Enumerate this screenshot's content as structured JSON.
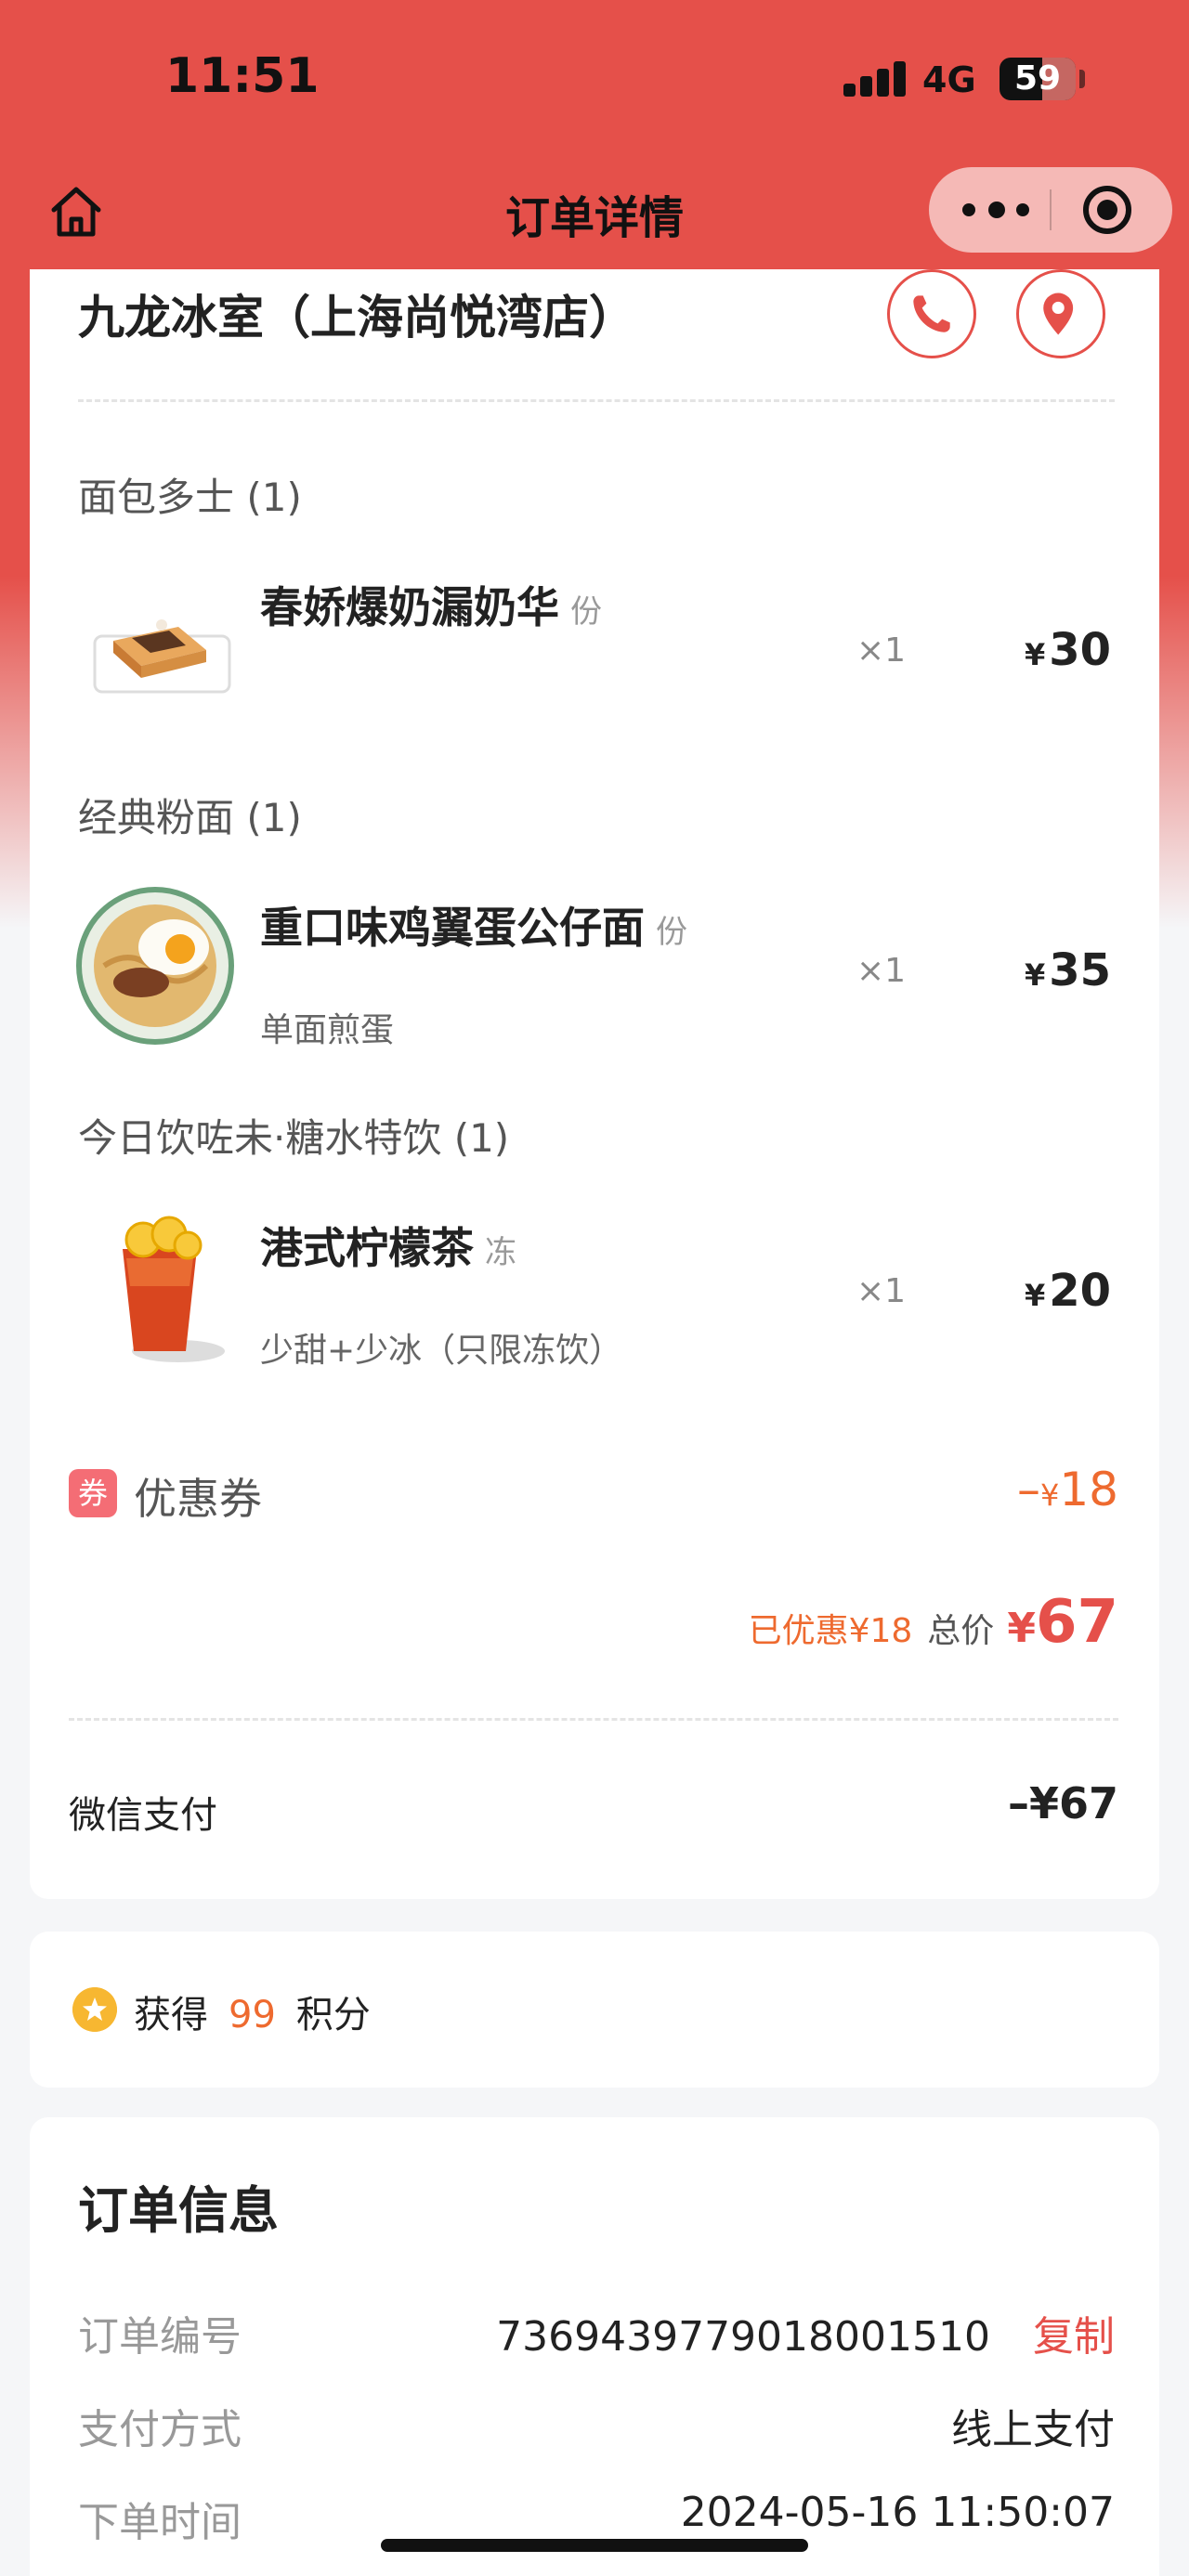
{
  "status_bar": {
    "time": "11:51",
    "network": "4G",
    "battery": "59"
  },
  "nav": {
    "title": "订单详情"
  },
  "store": {
    "name": "九龙冰室（上海尚悦湾店）"
  },
  "categories": [
    {
      "name": "面包多士 (1)",
      "items": [
        {
          "name": "春娇爆奶漏奶华",
          "unit": "份",
          "spec": "",
          "qty": "×1",
          "currency": "¥",
          "price": "30"
        }
      ]
    },
    {
      "name": "经典粉面 (1)",
      "items": [
        {
          "name": "重口味鸡翼蛋公仔面",
          "unit": "份",
          "spec": "单面煎蛋",
          "qty": "×1",
          "currency": "¥",
          "price": "35"
        }
      ]
    },
    {
      "name": "今日饮咗未·糖水特饮 (1)",
      "items": [
        {
          "name": "港式柠檬茶",
          "unit": "冻",
          "spec": "少甜+少冰（只限冻饮）",
          "qty": "×1",
          "currency": "¥",
          "price": "20"
        }
      ]
    }
  ],
  "coupon": {
    "badge": "券",
    "label": "优惠券",
    "prefix": "–",
    "currency": "¥",
    "amount": "18"
  },
  "summary": {
    "saved": "已优惠¥18",
    "total_label": "总价",
    "currency": "¥",
    "total": "67"
  },
  "payment": {
    "label": "微信支付",
    "amount": "–¥67"
  },
  "points": {
    "prefix": "获得",
    "value": "99",
    "suffix": "积分"
  },
  "order_info": {
    "title": "订单信息",
    "rows": [
      {
        "label": "订单编号",
        "value": "7369439779018001510",
        "action": "复制"
      },
      {
        "label": "支付方式",
        "value": "线上支付"
      },
      {
        "label": "下单时间",
        "value": "2024-05-16 11:50:07"
      }
    ]
  },
  "colors": {
    "brand_red": "#e5504a",
    "accent_orange": "#ee6a2f",
    "background": "#f5f6f8"
  },
  "icons": [
    "home-icon",
    "more-dots-icon",
    "close-target-icon",
    "phone-icon",
    "location-icon",
    "coupon-icon",
    "points-star-icon"
  ]
}
